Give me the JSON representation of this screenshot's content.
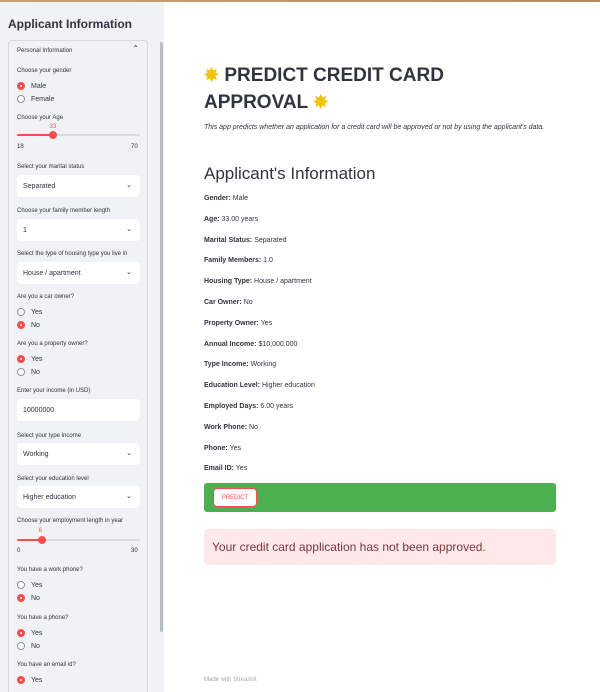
{
  "sidebar": {
    "title": "Applicant Information",
    "expander_label": "Personal Information",
    "gender": {
      "label": "Choose your gender",
      "options": [
        "Male",
        "Female"
      ],
      "selected": "Male"
    },
    "age": {
      "label": "Choose your Age",
      "value": "33",
      "min": "18",
      "max": "70",
      "fraction": 0.29
    },
    "marital": {
      "label": "Select your marital status",
      "value": "Separated"
    },
    "family": {
      "label": "Choose your family member length",
      "value": "1"
    },
    "housing": {
      "label": "Select the type of housing type you live in",
      "value": "House / apartment"
    },
    "car": {
      "label": "Are you a car owner?",
      "options": [
        "Yes",
        "No"
      ],
      "selected": "No"
    },
    "property": {
      "label": "Are you a property owner?",
      "options": [
        "Yes",
        "No"
      ],
      "selected": "Yes"
    },
    "income": {
      "label": "Enter your income (in USD)",
      "value": "10000000"
    },
    "income_type": {
      "label": "Select your type income",
      "value": "Working"
    },
    "education": {
      "label": "Select your education level",
      "value": "Higher education"
    },
    "employment": {
      "label": "Choose your employment length in year",
      "value": "6",
      "min": "0",
      "max": "30",
      "fraction": 0.2
    },
    "work_phone": {
      "label": "You have a work phone?",
      "options": [
        "Yes",
        "No"
      ],
      "selected": "No"
    },
    "phone": {
      "label": "You have a phone?",
      "options": [
        "Yes",
        "No"
      ],
      "selected": "Yes"
    },
    "email": {
      "label": "You have an email id?",
      "options": [
        "Yes"
      ],
      "selected": "Yes"
    }
  },
  "main": {
    "title": "PREDICT CREDIT CARD APPROVAL",
    "star_icon": "✸",
    "description": "This app predicts whether an application for a credit card will be approved or not by using the applicant's data.",
    "section_title": "Applicant's Information",
    "info": [
      {
        "key": "Gender:",
        "value": "Male"
      },
      {
        "key": "Age:",
        "value": " 33.00 years"
      },
      {
        "key": "Marital Status:",
        "value": "Separated"
      },
      {
        "key": "Family Members:",
        "value": "1.0"
      },
      {
        "key": "Housing Type:",
        "value": "House / apartment"
      },
      {
        "key": "Car Owner:",
        "value": "No"
      },
      {
        "key": "Property Owner:",
        "value": "Yes"
      },
      {
        "key": "Annual Income:",
        "value": "$10,000,000"
      },
      {
        "key": "Type Income:",
        "value": "Working"
      },
      {
        "key": "Education Level:",
        "value": "Higher education"
      },
      {
        "key": "Employed Days:",
        "value": " 6.00 years"
      },
      {
        "key": "Work Phone:",
        "value": "No"
      },
      {
        "key": "Phone:",
        "value": "Yes"
      },
      {
        "key": "Email ID:",
        "value": "Yes"
      }
    ],
    "predict_label": "PREDICT",
    "result": "Your credit card application has not been approved.",
    "footer": "Made with Streamlit"
  },
  "colors": {
    "accent": "#ff4b4b",
    "success_bar": "#4caf50",
    "error_bg": "#fde9ea",
    "error_text": "#7d353b",
    "sidebar_bg": "#f0f2f6"
  }
}
